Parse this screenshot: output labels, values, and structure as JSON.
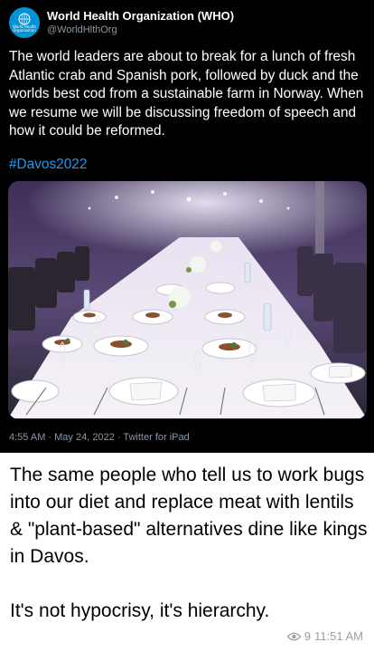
{
  "tweet": {
    "author_name": "World Health Organization (WHO)",
    "author_handle": "@WorldHlthOrg",
    "avatar_text_line1": "World Health",
    "avatar_text_line2": "Organization",
    "text": "The world leaders are about to break for a lunch of fresh Atlantic crab and Spanish pork, followed by duck and the worlds best cod from a sustainable farm in Norway. When we resume we will be discussing freedom of speech and how it could be reformed.",
    "hashtag": "#Davos2022",
    "meta": "4:55 AM · May 24, 2022 · Twitter for iPad",
    "image_icon": "banquet-table-photo",
    "colors": {
      "background": "#000000",
      "hashtag": "#1d9bf0",
      "secondary": "#8b98a5"
    }
  },
  "caption": {
    "line1": "The same people who tell us to work bugs into our diet and replace meat with lentils & \"plant-based\" alternatives dine like kings in Davos.",
    "line2": "It's not hypocrisy, it's hierarchy."
  },
  "post_meta": {
    "views_icon": "eye-icon",
    "views": "9",
    "time": "11:51 AM"
  }
}
